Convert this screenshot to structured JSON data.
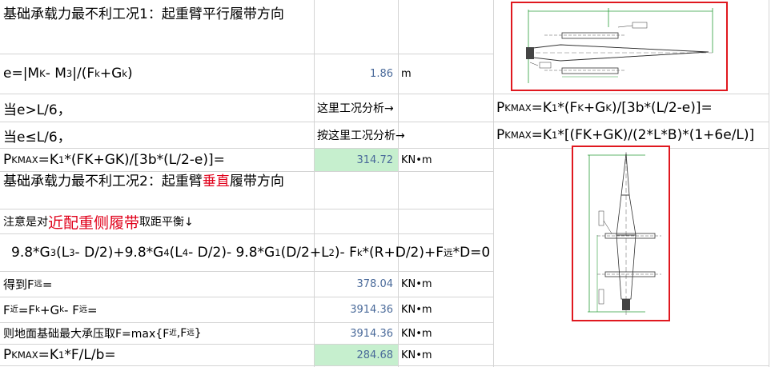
{
  "rows": {
    "title1": "基础承载力最不利工况1：起重臂平行履带方向",
    "e_formula": "e=|M",
    "e_value": "1.86",
    "e_unit": "m",
    "case_gt": "当e>L/6，",
    "case_gt_note": "这里工况分析→",
    "case_le": "当e≤L/6，",
    "case_le_note": "按这里工况分析→",
    "pkmax1_value": "314.72",
    "pkmax1_unit": "KN•m",
    "title2_part1": "基础承载力最不利工况2：起重臂",
    "title2_red": "垂直",
    "title2_part2": "履带方向",
    "note_prefix": "注意是对",
    "note_red": "近配重侧履带",
    "note_suffix": "取距平衡↓",
    "far_label": "得到F",
    "far_value": "378.04",
    "far_unit": "KN•m",
    "near_value": "3914.36",
    "near_unit": "KN•m",
    "fmax_value": "3914.36",
    "fmax_unit": "KN•m",
    "pkmax2_value": "284.68",
    "pkmax2_unit": "KN•m"
  },
  "colors": {
    "highlight": "#c6efce",
    "value_text": "#4a6a9a",
    "emphasis": "#e0001a",
    "figure_border": "#e0181f"
  }
}
